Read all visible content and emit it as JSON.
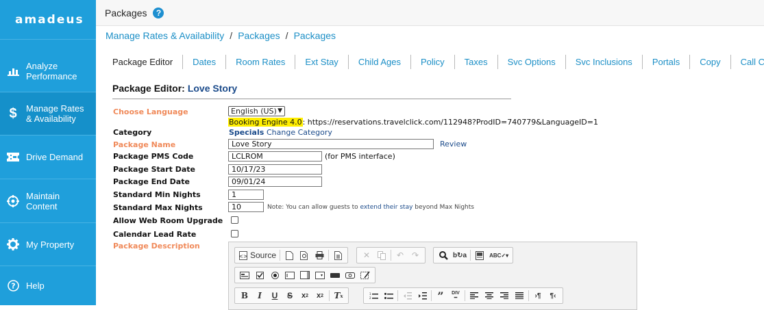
{
  "sidebar": {
    "logo": "amadeus",
    "items": [
      {
        "label_line1": "Analyze",
        "label_line2": "Performance",
        "icon": "bar-chart-icon"
      },
      {
        "label_line1": "Manage Rates",
        "label_line2": "& Availability",
        "icon": "dollar-icon"
      },
      {
        "label_line1": "Drive Demand",
        "label_line2": "",
        "icon": "ticket-icon"
      },
      {
        "label_line1": "Maintain",
        "label_line2": "Content",
        "icon": "crosshair-icon"
      },
      {
        "label_line1": "My Property",
        "label_line2": "",
        "icon": "gear-icon"
      },
      {
        "label_line1": "Help",
        "label_line2": "",
        "icon": "question-icon"
      }
    ],
    "active_index": 1
  },
  "topbar": {
    "title": "Packages",
    "help_icon": "?"
  },
  "breadcrumb": [
    "Manage Rates & Availability",
    "Packages",
    "Packages"
  ],
  "breadcrumb_sep": "/",
  "tabs": [
    "Package Editor",
    "Dates",
    "Room Rates",
    "Ext Stay",
    "Child Ages",
    "Policy",
    "Taxes",
    "Svc Options",
    "Svc Inclusions",
    "Portals",
    "Copy",
    "Call Ctr Image"
  ],
  "active_tab": "Package Editor",
  "editor": {
    "heading": "Package Editor:",
    "package_name_heading": "Love Story",
    "labels": {
      "choose_language": "Choose Language",
      "category": "Category",
      "package_name": "Package Name",
      "pms_code": "Package PMS Code",
      "start_date": "Package Start Date",
      "end_date": "Package End Date",
      "min_nights": "Standard Min Nights",
      "max_nights": "Standard Max Nights",
      "web_upgrade": "Allow Web Room Upgrade",
      "lead_rate": "Calendar Lead Rate",
      "description": "Package Description"
    },
    "language_value": "English (US)",
    "booking_engine_label": "Booking Engine 4.0",
    "booking_url": ": https://reservations.travelclick.com/112948?ProdID=740779&LanguageID=1",
    "category_value": "Specials",
    "change_category": "Change Category",
    "package_name_value": "Love Story",
    "review_link": "Review",
    "pms_code_value": "LCLROM",
    "pms_note": "(for PMS interface)",
    "start_date_value": "10/17/23",
    "end_date_value": "09/01/24",
    "min_nights_value": "1",
    "max_nights_value": "10",
    "max_note_before": "Note: You can allow guests to ",
    "max_note_link": "extend their stay",
    "max_note_after": " beyond Max Nights",
    "web_upgrade_checked": false,
    "lead_rate_checked": false
  },
  "rte": {
    "source_label": "Source"
  }
}
